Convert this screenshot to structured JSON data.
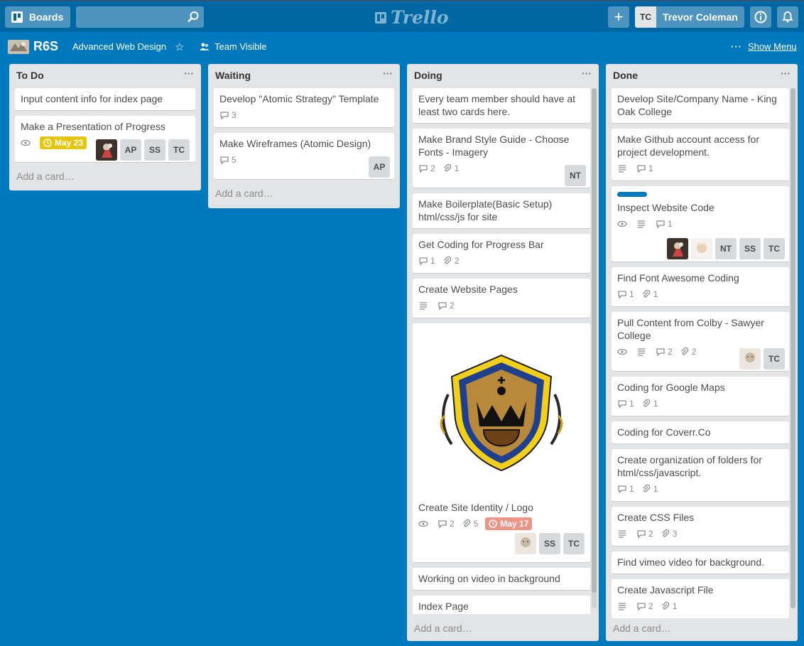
{
  "header": {
    "boards_label": "Boards",
    "logo_text": "Trello",
    "member_initials": "TC",
    "member_name": "Trevor Coleman"
  },
  "board": {
    "title": "R6S",
    "org": "Advanced Web Design",
    "visibility": "Team Visible",
    "show_menu": "Show Menu"
  },
  "lists": [
    {
      "name": "To Do",
      "add_card": "Add a card…",
      "cards": [
        {
          "title": "Input content info for index page"
        },
        {
          "title": "Make a Presentation of Progress",
          "due": "May 23",
          "members": [
            "AP",
            "SS",
            "TC"
          ]
        }
      ]
    },
    {
      "name": "Waiting",
      "add_card": "Add a card…",
      "cards": [
        {
          "title": "Develop \"Atomic Strategy\" Template",
          "comments": "3"
        },
        {
          "title": "Make Wireframes (Atomic Design)",
          "comments": "5",
          "members": [
            "AP"
          ]
        }
      ]
    },
    {
      "name": "Doing",
      "add_card": "Add a card…",
      "cards": [
        {
          "title": "Every team member should have at least two cards here."
        },
        {
          "title": "Make Brand Style Guide - Choose Fonts - Imagery",
          "comments": "2",
          "attachments": "1",
          "members": [
            "NT"
          ]
        },
        {
          "title": "Make Boilerplate(Basic Setup) html/css/js for site"
        },
        {
          "title": "Get Coding for Progress Bar",
          "comments": "1",
          "attachments": "2"
        },
        {
          "title": "Create Website Pages",
          "comments": "2"
        },
        {
          "title": "Create Site Identity / Logo",
          "comments": "2",
          "attachments": "5",
          "due": "May 17",
          "members": [
            "SS",
            "TC"
          ]
        },
        {
          "title": "Working on video in background"
        },
        {
          "title": "Index Page"
        }
      ]
    },
    {
      "name": "Done",
      "add_card": "Add a card…",
      "cards": [
        {
          "title": "Develop Site/Company Name - King Oak College"
        },
        {
          "title": "Make Github account access for project development.",
          "comments": "1"
        },
        {
          "title": "Inspect Website Code",
          "comments": "1",
          "members": [
            "NT",
            "SS",
            "TC"
          ]
        },
        {
          "title": "Find Font Awesome Coding",
          "comments": "1",
          "attachments": "1"
        },
        {
          "title": "Pull Content from Colby - Sawyer College",
          "comments": "2",
          "attachments": "2",
          "members": [
            "TC"
          ]
        },
        {
          "title": "Coding for Google Maps",
          "comments": "1",
          "attachments": "1"
        },
        {
          "title": "Coding for Coverr.Co"
        },
        {
          "title": "Create organization of folders for html/css/javascript.",
          "comments": "1",
          "attachments": "1"
        },
        {
          "title": "Create CSS Files",
          "comments": "2",
          "attachments": "3"
        },
        {
          "title": "Find vimeo video for background."
        },
        {
          "title": "Create Javascript File",
          "comments": "2",
          "attachments": "1"
        }
      ]
    }
  ],
  "colors": {
    "board_bg": "#0079bf",
    "header_bg": "#0067a3",
    "list_bg": "#e2e4e6",
    "due_soon": "#e6c60d",
    "due_overdue": "#ec9488",
    "label_blue": "#0079bf"
  }
}
